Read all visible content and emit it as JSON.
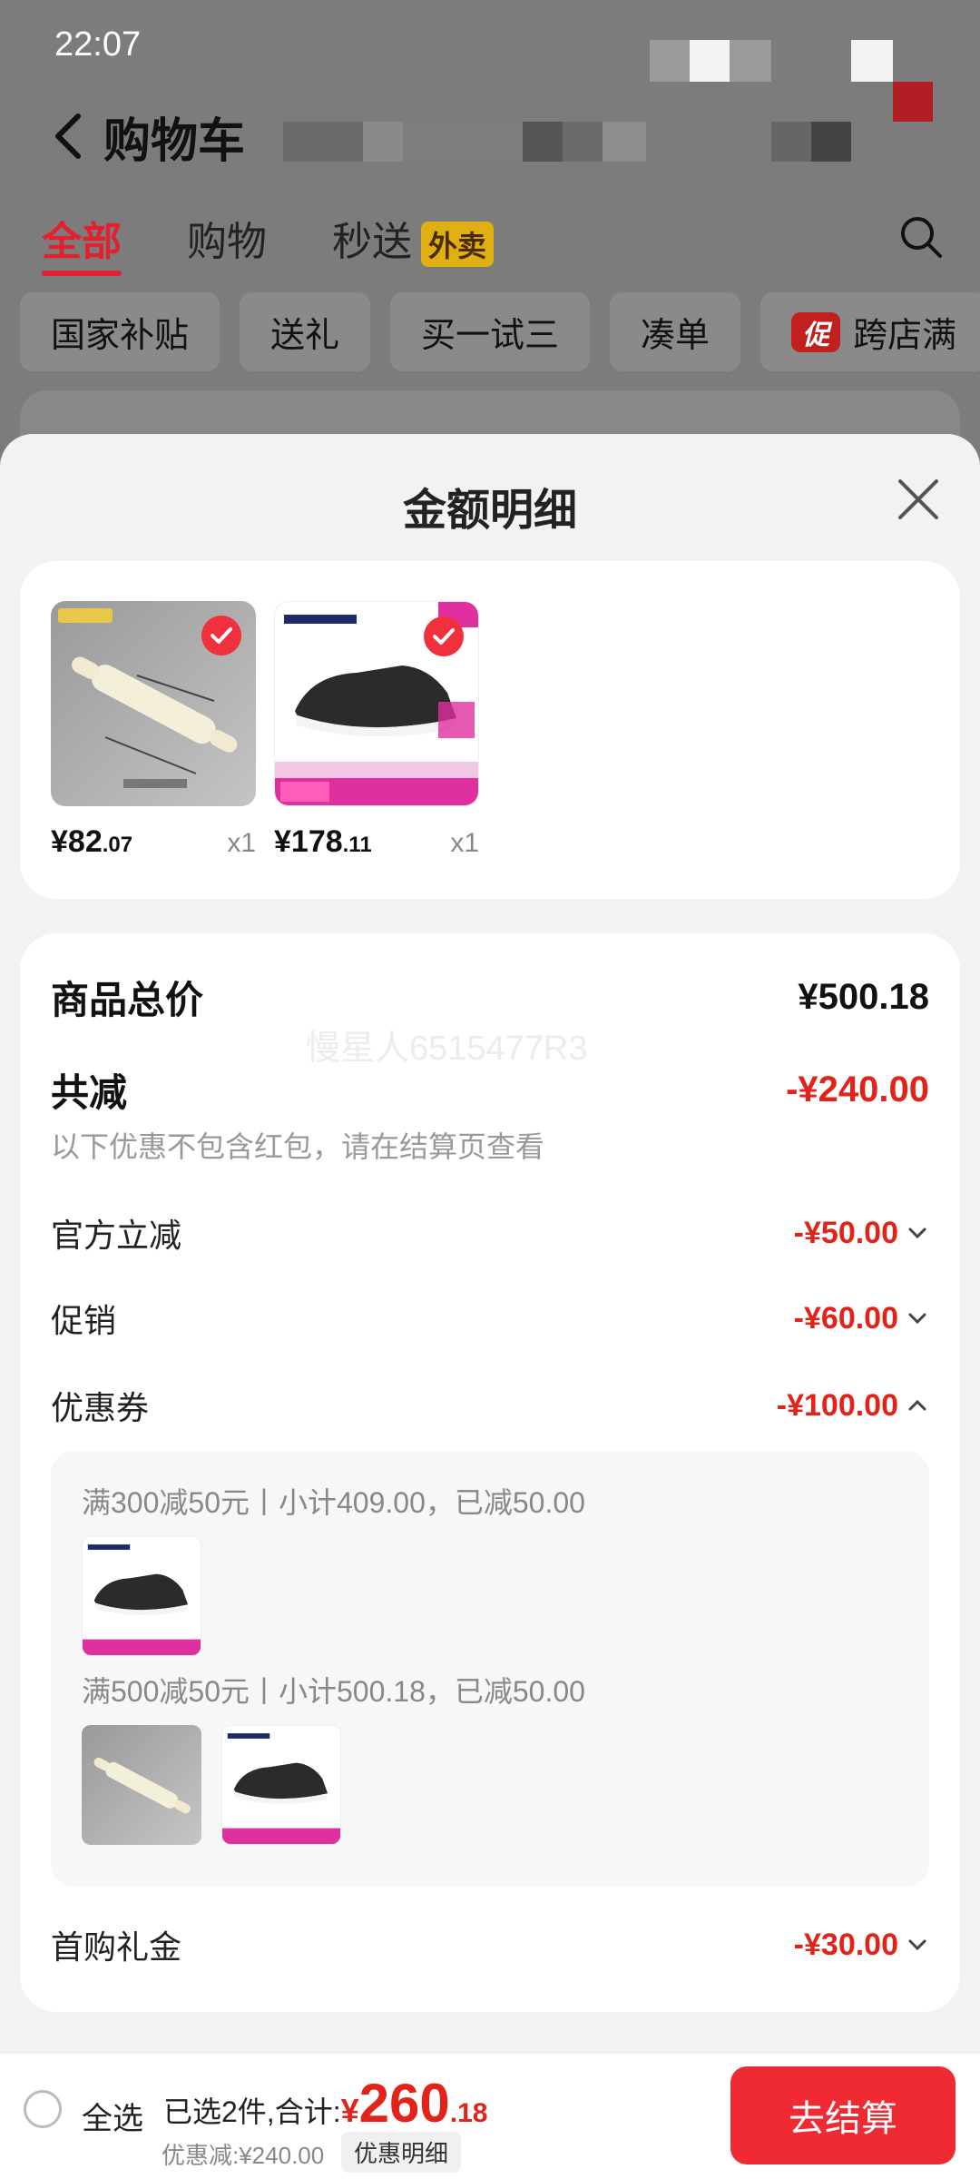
{
  "status_bar": {
    "time": "22:07"
  },
  "header": {
    "title": "购物车"
  },
  "tabs": [
    {
      "label": "全部",
      "active": true
    },
    {
      "label": "购物",
      "active": false
    },
    {
      "label": "秒送",
      "badge": "外卖",
      "active": false
    }
  ],
  "chips": [
    {
      "label": "国家补贴"
    },
    {
      "label": "送礼"
    },
    {
      "label": "买一试三"
    },
    {
      "label": "凑单"
    },
    {
      "label": "跨店满",
      "icon_text": "促"
    }
  ],
  "sheet": {
    "title": "金额明细",
    "products": [
      {
        "image": "rolling-pin",
        "price_int": "¥82",
        "price_dec": ".07",
        "qty": "x1"
      },
      {
        "image": "skechers-shoe",
        "price_int": "¥178",
        "price_dec": ".11",
        "qty": "x1"
      }
    ],
    "watermark": "慢星人6515477R3",
    "total_label": "商品总价",
    "total_value": "¥500.18",
    "reduce_label": "共减",
    "reduce_value": "-¥240.00",
    "reduce_note": "以下优惠不包含红包，请在结算页查看",
    "lines": [
      {
        "label": "官方立减",
        "value": "-¥50.00",
        "expanded": false
      },
      {
        "label": "促销",
        "value": "-¥60.00",
        "expanded": false
      },
      {
        "label": "优惠券",
        "value": "-¥100.00",
        "expanded": true
      }
    ],
    "coupons": [
      {
        "text": "满300减50元丨小计409.00，已减50.00",
        "items": [
          "skechers-shoe"
        ]
      },
      {
        "text": "满500减50元丨小计500.18，已减50.00",
        "items": [
          "rolling-pin",
          "skechers-shoe"
        ]
      }
    ],
    "gift_label": "首购礼金",
    "gift_value": "-¥30.00"
  },
  "bottom_bar": {
    "select_all": "全选",
    "selected_text": "已选2件,合计:",
    "currency": "¥",
    "total_int": "260",
    "total_dec": ".18",
    "saved_text": "优惠减:¥240.00",
    "detail_button": "优惠明细",
    "checkout_button": "去结算"
  },
  "colors": {
    "accent": "#e2231a",
    "checkout": "#f02a33",
    "tab_active": "#e4202f"
  }
}
